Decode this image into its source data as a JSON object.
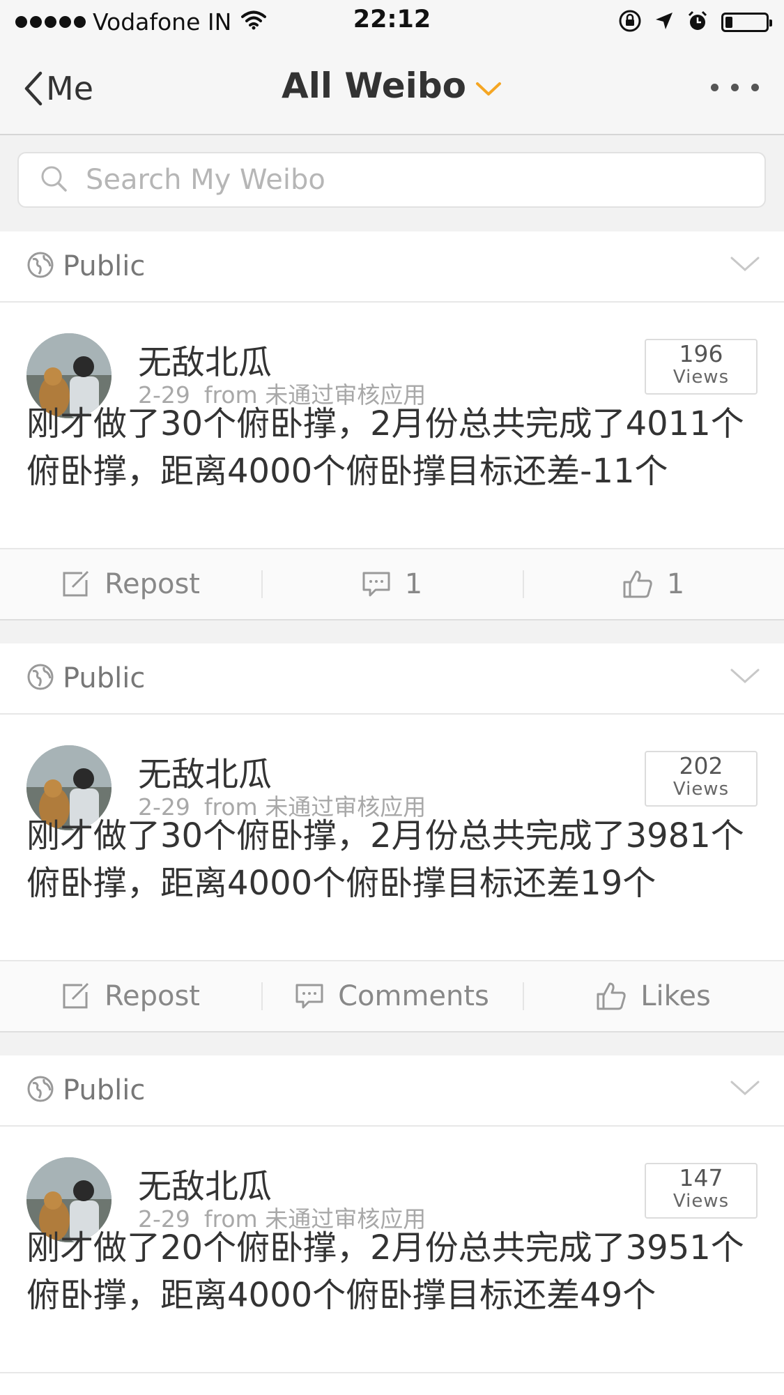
{
  "status_bar": {
    "carrier": "Vodafone IN",
    "time": "22:12",
    "battery_level": 0.18
  },
  "nav": {
    "back_label": "Me",
    "title": "All Weibo"
  },
  "search": {
    "placeholder": "Search My Weibo"
  },
  "posts": [
    {
      "visibility": "Public",
      "username": "无敌北瓜",
      "date": "2-29",
      "source": "from 未通过审核应用",
      "views_count": "196",
      "views_label": "Views",
      "text": "刚才做了30个俯卧撑，2月份总共完成了4011个俯卧撑，距离4000个俯卧撑目标还差-11个",
      "repost_label": "Repost",
      "comment_label": "1",
      "like_label": "1"
    },
    {
      "visibility": "Public",
      "username": "无敌北瓜",
      "date": "2-29",
      "source": "from 未通过审核应用",
      "views_count": "202",
      "views_label": "Views",
      "text": "刚才做了30个俯卧撑，2月份总共完成了3981个俯卧撑，距离4000个俯卧撑目标还差19个",
      "repost_label": "Repost",
      "comment_label": "Comments",
      "like_label": "Likes"
    },
    {
      "visibility": "Public",
      "username": "无敌北瓜",
      "date": "2-29",
      "source": "from 未通过审核应用",
      "views_count": "147",
      "views_label": "Views",
      "text": "刚才做了20个俯卧撑，2月份总共完成了3951个俯卧撑，距离4000个俯卧撑目标还差49个"
    }
  ],
  "colors": {
    "accent": "#f5a623",
    "text": "#333333",
    "muted": "#a8a8a8"
  }
}
